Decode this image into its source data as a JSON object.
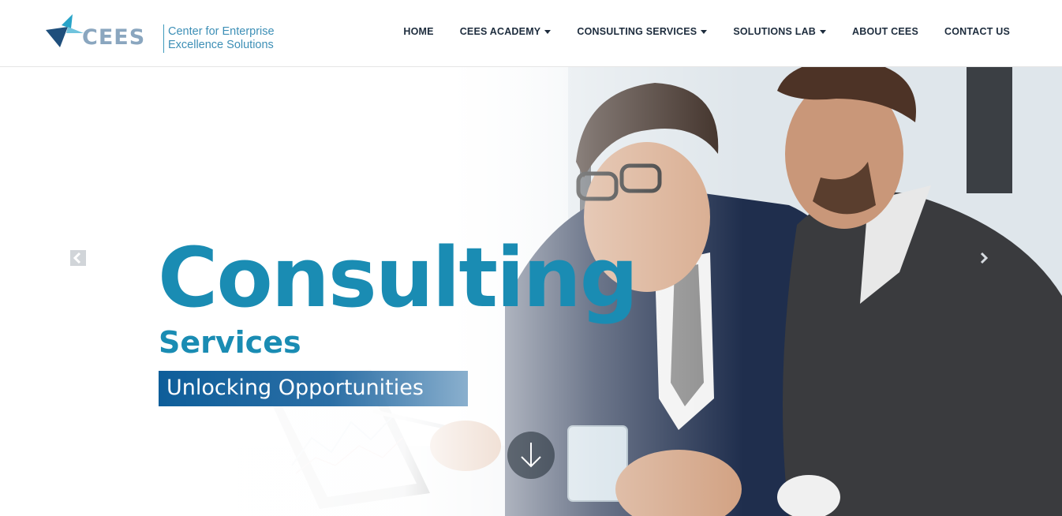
{
  "brand": {
    "logo_word": "CEES",
    "logo_line1": "Center for Enterprise",
    "logo_line2": "Excellence Solutions",
    "colors": {
      "primary": "#1a8cb3",
      "logo_gray": "#8aa6bf",
      "tagline_bg": "#0e5e9a",
      "nav_text": "#1d2c3d"
    }
  },
  "nav": {
    "items": [
      {
        "label": "HOME",
        "dropdown": false
      },
      {
        "label": "CEES ACADEMY",
        "dropdown": true
      },
      {
        "label": "CONSULTING SERVICES",
        "dropdown": true
      },
      {
        "label": "SOLUTIONS LAB",
        "dropdown": true
      },
      {
        "label": "ABOUT CEES",
        "dropdown": false
      },
      {
        "label": "CONTACT US",
        "dropdown": false
      }
    ]
  },
  "hero": {
    "title": "Consulting",
    "subtitle": "Services",
    "tagline": "Unlocking Opportunities",
    "icons": {
      "prev": "chevron-left-icon",
      "next": "chevron-right-icon",
      "scroll": "arrow-down-icon"
    }
  }
}
